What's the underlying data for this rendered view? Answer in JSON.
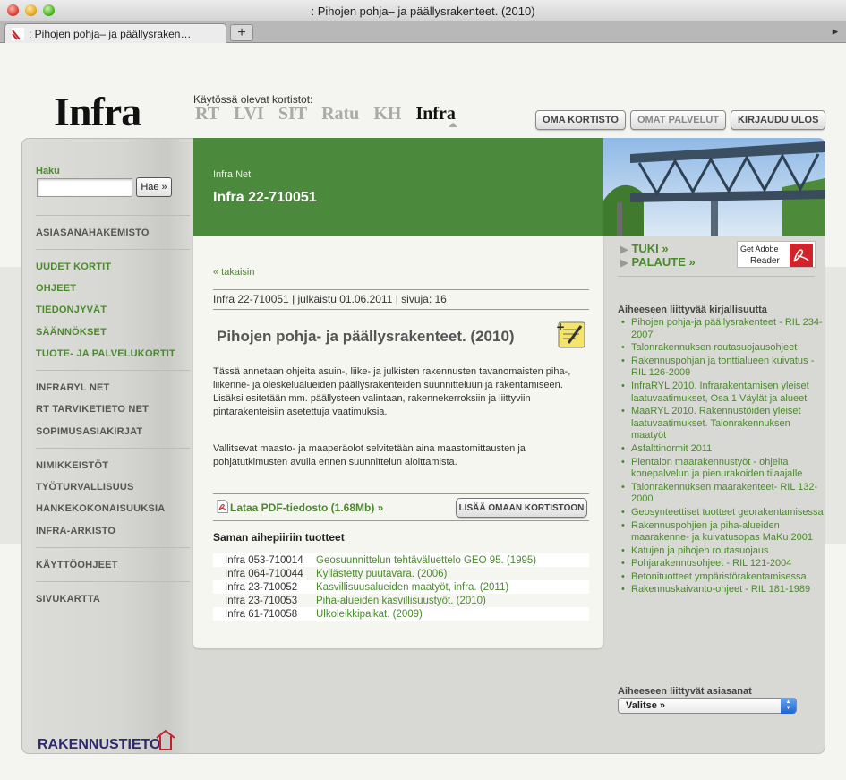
{
  "window": {
    "title": ": Pihojen pohja– ja päällysrakenteet. (2010)",
    "tab_label": ": Pihojen pohja– ja päällysraken…",
    "new_tab_label": "+",
    "tab_menu_label": "▸"
  },
  "header": {
    "logo": "Infra",
    "cards_label": "Käytössä olevat kortistot:",
    "cards": [
      "RT",
      "LVI",
      "SIT",
      "Ratu",
      "KH",
      "Infra"
    ],
    "active_card": "Infra",
    "buttons": {
      "my_cards": "OMA KORTISTO",
      "my_services": "OMAT PALVELUT",
      "logout": "KIRJAUDU ULOS"
    }
  },
  "sidebar": {
    "search_label": "Haku",
    "search_value": "",
    "search_button": "Hae »",
    "groups": [
      [
        "ASIASANAHAKEMISTO"
      ],
      [
        "UUDET KORTIT",
        "OHJEET",
        "TIEDONJYVÄT",
        "SÄÄNNÖKSET",
        "TUOTE- JA PALVELUKORTIT"
      ],
      [
        "INFRARYL NET",
        "RT TARVIKETIETO NET",
        "SOPIMUSASIAKIRJAT"
      ],
      [
        "NIMIKKEISTÖT",
        "TYÖTURVALLISUUS",
        "HANKEKOKONAISUUKSIA",
        "INFRA-ARKISTO"
      ],
      [
        "KÄYTTÖOHJEET"
      ],
      [
        "SIVUKARTTA"
      ]
    ],
    "footer_logo": "RAKENNUSTIETO"
  },
  "content": {
    "breadcrumb": "Infra Net",
    "doc_id": "Infra 22-710051",
    "back_link": "« takaisin",
    "meta": "Infra 22-710051 | julkaistu 01.06.2011 | sivuja: 16",
    "title": "Pihojen pohja- ja päällysrakenteet. (2010)",
    "paragraphs": [
      "Tässä annetaan ohjeita asuin-, liike- ja julkisten rakennusten tavanomaisten piha-, liikenne- ja oleskelualueiden päällysrakenteiden suunnitteluun ja rakentamiseen. Lisäksi esitetään mm. päällysteen valintaan, rakennekerroksiin ja liittyviin pintarakenteisiin asetettuja vaatimuksia.",
      "Vallitsevat maasto- ja maaperäolot selvitetään aina maastomittausten ja pohjatutkimusten avulla ennen suunnittelun aloittamista."
    ],
    "pdf_link": "Lataa PDF-tiedosto (1.68Mb) »",
    "add_button": "LISÄÄ OMAAN KORTISTOON",
    "related_heading": "Saman aihepiiriin tuotteet",
    "related": [
      {
        "code": "Infra 053-710014",
        "title": "Geosuunnittelun tehtäväluettelo GEO 95. (1995)"
      },
      {
        "code": "Infra 064-710044",
        "title": "Kyllästetty puutavara. (2006)"
      },
      {
        "code": "Infra 23-710052",
        "title": "Kasvillisuusalueiden maatyöt, infra. (2011)"
      },
      {
        "code": "Infra 23-710053",
        "title": "Piha-alueiden kasvillisuustyöt. (2010)"
      },
      {
        "code": "Infra 61-710058",
        "title": "Ulkoleikkipaikat. (2009)"
      }
    ]
  },
  "right": {
    "support": "TUKI »",
    "feedback": "PALAUTE »",
    "reader_line1": "Get Adobe",
    "reader_line2": "Reader",
    "literature_heading": "Aiheeseen liittyvää kirjallisuutta",
    "literature": [
      "Pihojen pohja-ja päällysrakenteet - RIL 234-2007",
      "Talonrakennuksen routasuojausohjeet",
      "Rakennuspohjan ja tonttialueen kuivatus - RIL 126-2009",
      "InfraRYL 2010. Infrarakentamisen yleiset laatuvaatimukset, Osa 1 Väylät ja alueet",
      "MaaRYL 2010. Rakennustöiden yleiset laatuvaatimukset. Talonrakennuksen maatyöt",
      "Asfalttinormit 2011",
      "Pientalon maarakennustyöt - ohjeita konepalvelun ja pienurakoiden tilaajalle",
      "Talonrakennuksen maarakenteet- RIL 132-2000",
      "Geosynteettiset tuotteet georakentamisessa",
      "Rakennuspohjien ja piha-alueiden maarakenne- ja kuivatusopas MaKu 2001",
      "Katujen ja pihojen routasuojaus",
      "Pohjarakennusohjeet - RIL 121-2004",
      "Betonituotteet ympäristörakentamisessa",
      "Rakennuskaivanto-ohjeet - RIL 181-1989"
    ],
    "keywords_heading": "Aiheeseen liittyvät asiasanat",
    "keywords_select": "Valitse »"
  },
  "colors": {
    "brand_green": "#4b8a3c",
    "link_green": "#4a8a2c"
  }
}
